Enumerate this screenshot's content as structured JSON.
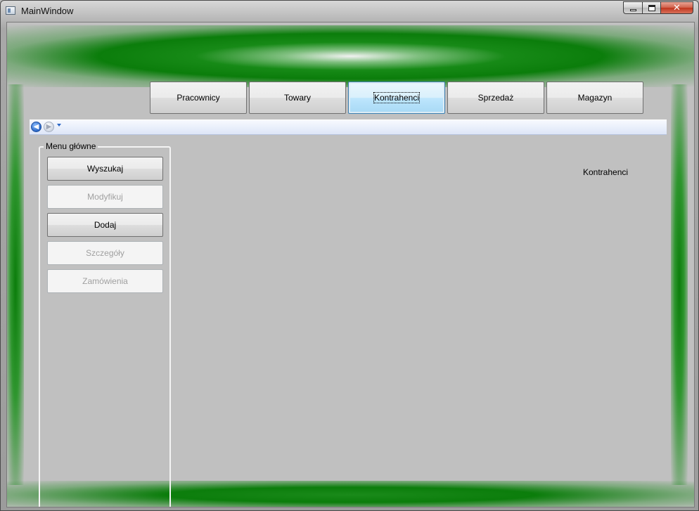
{
  "window": {
    "title": "MainWindow"
  },
  "tabs": [
    {
      "label": "Pracownicy",
      "active": false
    },
    {
      "label": "Towary",
      "active": false
    },
    {
      "label": "Kontrahenci",
      "active": true
    },
    {
      "label": "Sprzedaż",
      "active": false
    },
    {
      "label": "Magazyn",
      "active": false
    }
  ],
  "navigation": {
    "back_icon": "back-arrow-icon",
    "forward_icon": "forward-arrow-icon",
    "dropdown_icon": "chevron-down-icon"
  },
  "menu": {
    "title": "Menu główne",
    "buttons": [
      {
        "label": "Wyszukaj",
        "enabled": true
      },
      {
        "label": "Modyfikuj",
        "enabled": false
      },
      {
        "label": "Dodaj",
        "enabled": true
      },
      {
        "label": "Szczegóły",
        "enabled": false
      },
      {
        "label": "Zamówienia",
        "enabled": false
      }
    ]
  },
  "content": {
    "page_label": "Kontrahenci"
  },
  "colors": {
    "accent_green": "#0b7d0b",
    "client_bg": "#c0c0c0",
    "active_tab": "#bee6fd"
  }
}
